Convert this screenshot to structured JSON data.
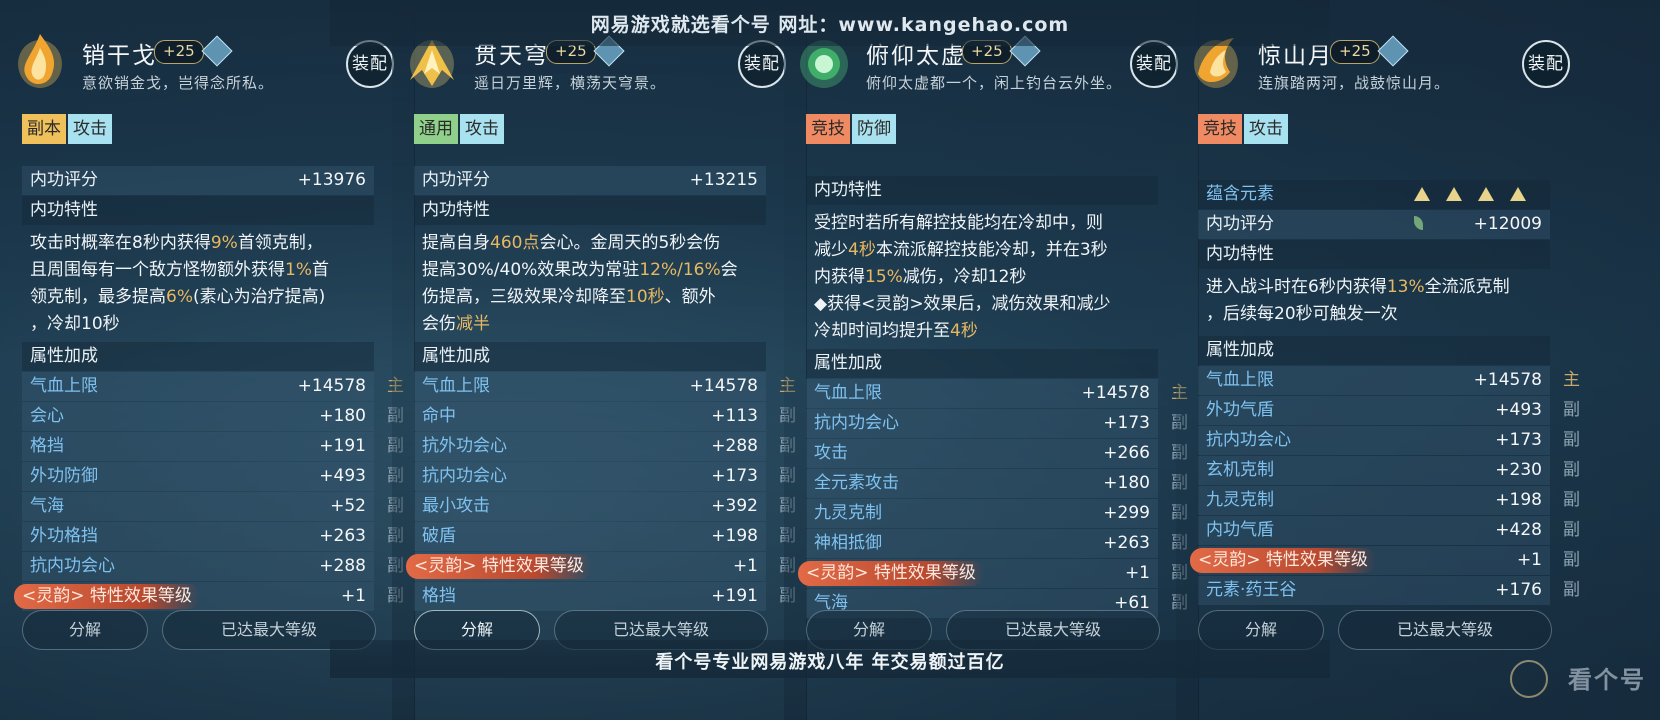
{
  "banner_top": "网易游戏就选看个号  网址：www.kangehao.com",
  "banner_bottom": "看个号专业网易游戏八年  年交易额过百亿",
  "watermark": "看个号",
  "equip_label": "装配",
  "dismantle_label": "分解",
  "maxlevel_label": "已达最大等级",
  "ling_label": "<灵韵>",
  "cards": [
    {
      "name": "销干戈",
      "level": "+25",
      "desc": "意欲销金戈，岂得念所私。",
      "tags": [
        {
          "text": "副本",
          "color": "#f0c05a"
        },
        {
          "text": "攻击",
          "color": "#a8e2f0"
        }
      ],
      "score_label": "内功评分",
      "score": "+13976",
      "trait_label": "内功特性",
      "trait_lines": [
        "攻击时概率在8秒内获得9%首领克制，",
        "且周围每有一个敌方怪物额外获得1%首",
        "领克制，最多提高6%(素心为治疗提高)",
        "，冷却10秒"
      ],
      "attr_label": "属性加成",
      "attrs": [
        {
          "label": "气血上限",
          "value": "+14578",
          "sfx": "主"
        },
        {
          "label": "会心",
          "value": "+180",
          "sfx": "副"
        },
        {
          "label": "格挡",
          "value": "+191",
          "sfx": "副"
        },
        {
          "label": "外功防御",
          "value": "+493",
          "sfx": "副"
        },
        {
          "label": "气海",
          "value": "+52",
          "sfx": "副"
        },
        {
          "label": "外功格挡",
          "value": "+263",
          "sfx": "副"
        },
        {
          "label": "抗内功会心",
          "value": "+288",
          "sfx": "副"
        },
        {
          "label": "特性效果等级",
          "value": "+1",
          "sfx": "副",
          "ling": true
        }
      ]
    },
    {
      "name": "贯天穹",
      "level": "+25",
      "desc": "遥日万里辉，横荡天穹景。",
      "tags": [
        {
          "text": "通用",
          "color": "#8fd08a"
        },
        {
          "text": "攻击",
          "color": "#a8e2f0"
        }
      ],
      "score_label": "内功评分",
      "score": "+13215",
      "trait_label": "内功特性",
      "trait_lines": [
        "提高自身460点会心。金周天的5秒会伤",
        "提高30%/40%效果改为常驻12%/16%会",
        "伤提高，三级效果冷却降至10秒、额外",
        "会伤减半"
      ],
      "attr_label": "属性加成",
      "attrs": [
        {
          "label": "气血上限",
          "value": "+14578",
          "sfx": "主"
        },
        {
          "label": "命中",
          "value": "+113",
          "sfx": "副"
        },
        {
          "label": "抗外功会心",
          "value": "+288",
          "sfx": "副"
        },
        {
          "label": "抗内功会心",
          "value": "+173",
          "sfx": "副"
        },
        {
          "label": "最小攻击",
          "value": "+392",
          "sfx": "副"
        },
        {
          "label": "破盾",
          "value": "+198",
          "sfx": "副"
        },
        {
          "label": "特性效果等级",
          "value": "+1",
          "sfx": "副",
          "ling": true
        },
        {
          "label": "格挡",
          "value": "+191",
          "sfx": "副"
        }
      ]
    },
    {
      "name": "俯仰太虚",
      "level": "+25",
      "desc": "俯仰太虚都一个，闲上钓台云外坐。",
      "tags": [
        {
          "text": "竞技",
          "color": "#f08a62"
        },
        {
          "text": "防御",
          "color": "#a8e2f0"
        }
      ],
      "trait_label": "内功特性",
      "trait_lines": [
        "受控时若所有解控技能均在冷却中，则",
        "减少4秒本流派解控技能冷却，并在3秒",
        "内获得15%减伤，冷却12秒",
        "◆获得<灵韵>效果后，减伤效果和减少",
        "冷却时间均提升至4秒"
      ],
      "attr_label": "属性加成",
      "attrs": [
        {
          "label": "气血上限",
          "value": "+14578",
          "sfx": "主"
        },
        {
          "label": "抗内功会心",
          "value": "+173",
          "sfx": "副"
        },
        {
          "label": "攻击",
          "value": "+266",
          "sfx": "副"
        },
        {
          "label": "全元素攻击",
          "value": "+180",
          "sfx": "副"
        },
        {
          "label": "九灵克制",
          "value": "+299",
          "sfx": "副"
        },
        {
          "label": "神相抵御",
          "value": "+263",
          "sfx": "副"
        },
        {
          "label": "特性效果等级",
          "value": "+1",
          "sfx": "副",
          "ling": true
        },
        {
          "label": "气海",
          "value": "+61",
          "sfx": "副"
        }
      ]
    },
    {
      "name": "惊山月",
      "level": "+25",
      "desc": "连旗踏两河，战鼓惊山月。",
      "tags": [
        {
          "text": "竞技",
          "color": "#f08a62"
        },
        {
          "text": "攻击",
          "color": "#a8e2f0"
        }
      ],
      "element_label": "蕴含元素",
      "score_label": "内功评分",
      "score": "+12009",
      "trait_label": "内功特性",
      "trait_lines": [
        "进入战斗时在6秒内获得13%全流派克制",
        "，后续每20秒可触发一次"
      ],
      "attr_label": "属性加成",
      "attrs": [
        {
          "label": "气血上限",
          "value": "+14578",
          "sfx": "主"
        },
        {
          "label": "外功气盾",
          "value": "+493",
          "sfx": "副"
        },
        {
          "label": "抗内功会心",
          "value": "+173",
          "sfx": "副"
        },
        {
          "label": "玄机克制",
          "value": "+230",
          "sfx": "副"
        },
        {
          "label": "九灵克制",
          "value": "+198",
          "sfx": "副"
        },
        {
          "label": "内功气盾",
          "value": "+428",
          "sfx": "副"
        },
        {
          "label": "特性效果等级",
          "value": "+1",
          "sfx": "副",
          "ling": true
        },
        {
          "label": "元素·药王谷",
          "value": "+176",
          "sfx": "副"
        }
      ]
    }
  ]
}
